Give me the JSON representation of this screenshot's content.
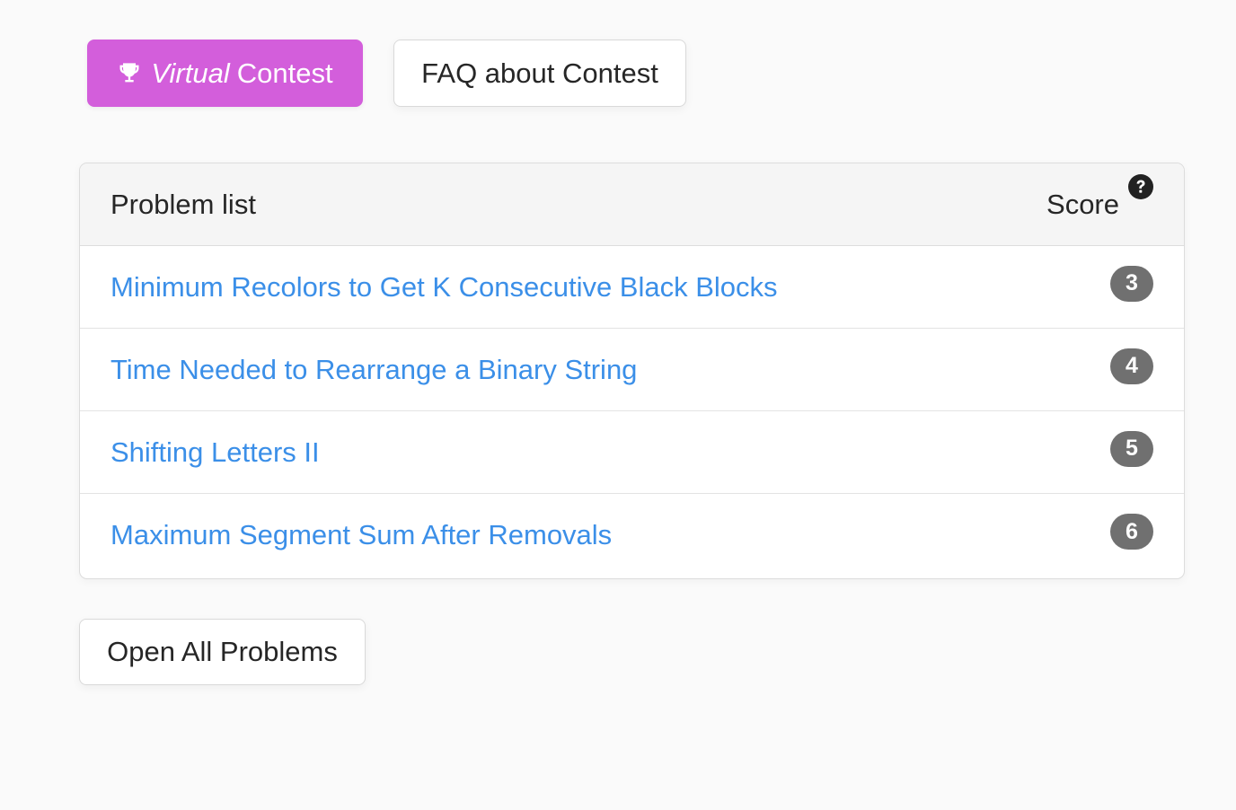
{
  "buttons": {
    "virtual_icon": "trophy-icon",
    "virtual_em": "Virtual",
    "virtual_rest": "Contest",
    "virtual_color": "#d35edb",
    "faq": "FAQ about Contest",
    "open_all": "Open All Problems"
  },
  "problem_list": {
    "header": "Problem list",
    "score_header": "Score",
    "score_help_icon": "question-circle-icon",
    "link_color": "#3b8fe8",
    "badge_color": "#707070",
    "rows": [
      {
        "title": "Minimum Recolors to Get K Consecutive Black Blocks",
        "score": "3"
      },
      {
        "title": "Time Needed to Rearrange a Binary String",
        "score": "4"
      },
      {
        "title": "Shifting Letters II",
        "score": "5"
      },
      {
        "title": "Maximum Segment Sum After Removals",
        "score": "6"
      }
    ]
  }
}
